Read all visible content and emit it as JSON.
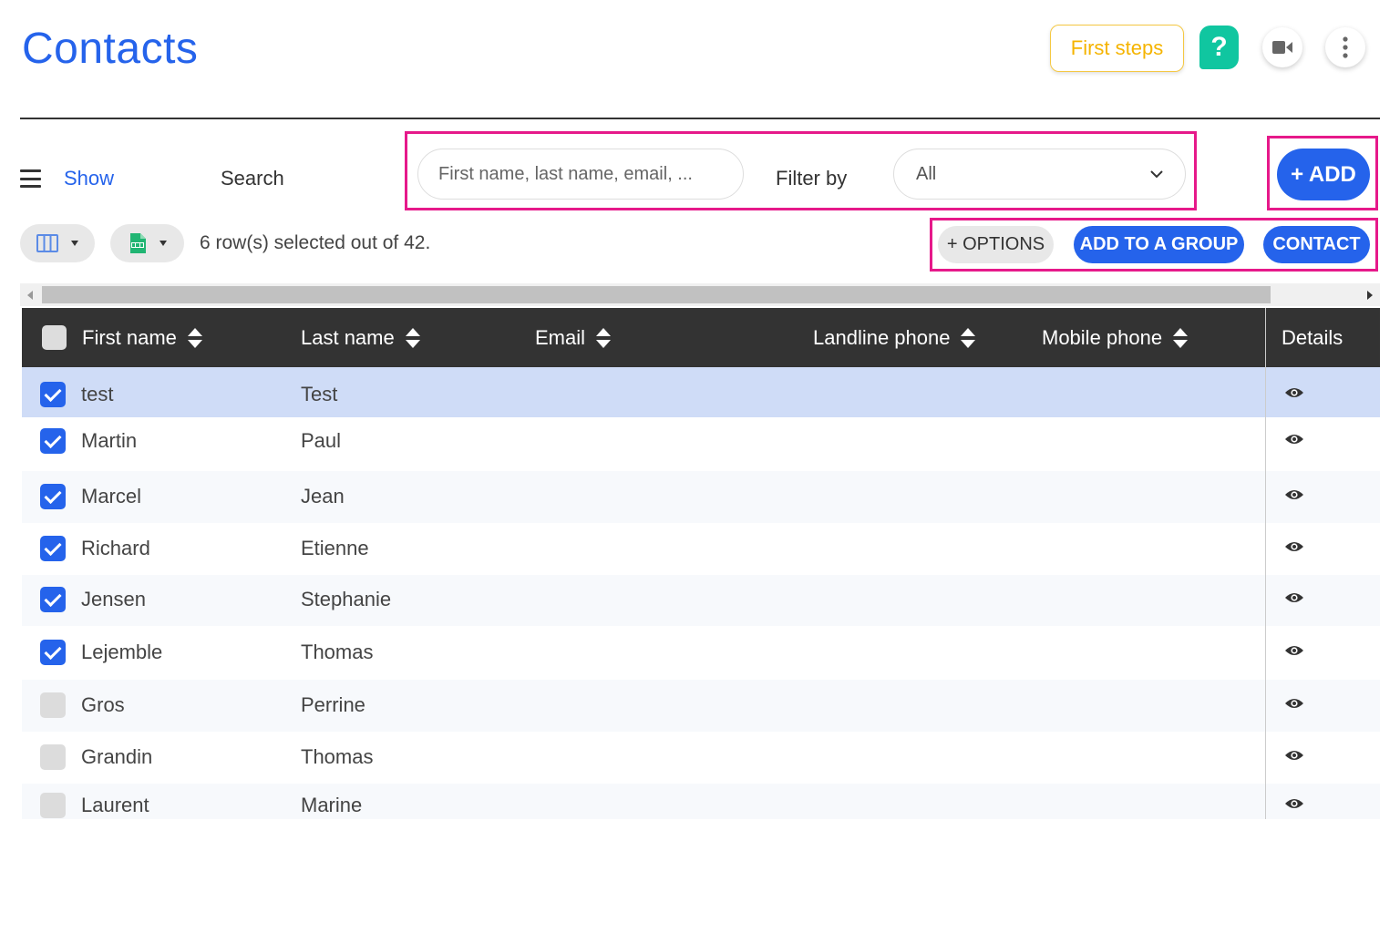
{
  "header": {
    "title": "Contacts",
    "first_steps_label": "First steps",
    "help_label": "?",
    "icons": {
      "video": "video-camera-icon",
      "more": "more-vertical-icon"
    }
  },
  "toolbar": {
    "show_label": "Show",
    "search_label": "Search",
    "search_placeholder": "First name, last name, email, ...",
    "filter_label": "Filter by",
    "filter_value": "All",
    "add_label": "+ ADD",
    "selection_status": "6 row(s) selected out of 42.",
    "options_label": "+ OPTIONS",
    "add_to_group_label": "ADD TO A GROUP",
    "contact_label": "CONTACT"
  },
  "colors": {
    "primary": "#2563eb",
    "highlight": "#e6198a",
    "help": "#10c6a0",
    "first_steps": "#f5b400",
    "header_bg": "#333333",
    "selected_row": "#cfdcf7"
  },
  "table": {
    "columns": [
      "First name",
      "Last name",
      "Email",
      "Landline phone",
      "Mobile phone",
      "Details"
    ],
    "rows": [
      {
        "first": "test",
        "last": "Test",
        "checked": true
      },
      {
        "first": "Martin",
        "last": "Paul",
        "checked": true
      },
      {
        "first": "Marcel",
        "last": "Jean",
        "checked": true
      },
      {
        "first": "Richard",
        "last": "Etienne",
        "checked": true
      },
      {
        "first": "Jensen",
        "last": "Stephanie",
        "checked": true
      },
      {
        "first": "Lejemble",
        "last": "Thomas",
        "checked": true
      },
      {
        "first": "Gros",
        "last": "Perrine",
        "checked": false
      },
      {
        "first": "Grandin",
        "last": "Thomas",
        "checked": false
      },
      {
        "first": "Laurent",
        "last": "Marine",
        "checked": false
      }
    ]
  }
}
